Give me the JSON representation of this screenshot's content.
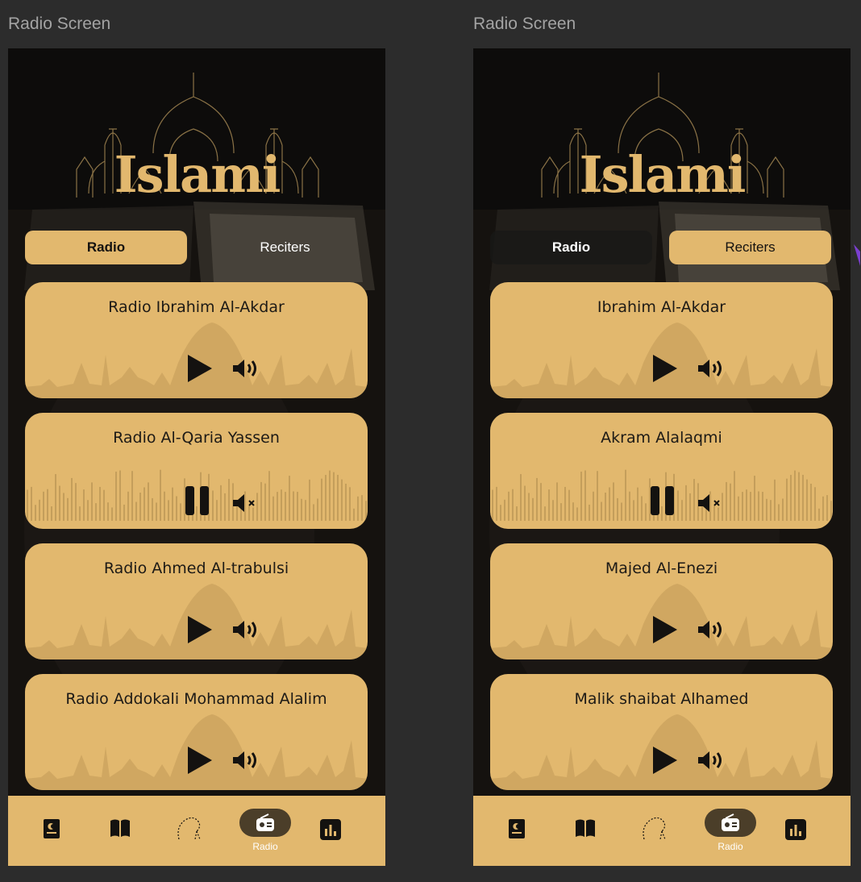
{
  "frames": [
    {
      "title": "Radio Screen",
      "logo": "Islami",
      "tabs": [
        {
          "label": "Radio",
          "active": true
        },
        {
          "label": "Reciters",
          "active": false
        }
      ],
      "cards": [
        {
          "title": "Radio Ibrahim Al-Akdar",
          "state": "paused",
          "muted": false
        },
        {
          "title": "Radio Al-Qaria Yassen",
          "state": "playing",
          "muted": true
        },
        {
          "title": "Radio Ahmed Al-trabulsi",
          "state": "paused",
          "muted": false
        },
        {
          "title": "Radio Addokali Mohammad Alalim",
          "state": "paused",
          "muted": false
        }
      ],
      "nav": {
        "items": [
          "quran-icon",
          "hadith-book-icon",
          "tasbeeh-icon",
          "radio-icon",
          "time-icon"
        ],
        "active_label": "Radio"
      }
    },
    {
      "title": "Radio Screen",
      "logo": "Islami",
      "tabs": [
        {
          "label": "Radio",
          "active": false
        },
        {
          "label": "Reciters",
          "active": true
        }
      ],
      "cards": [
        {
          "title": "Ibrahim Al-Akdar",
          "state": "paused",
          "muted": false
        },
        {
          "title": "Akram Alalaqmi",
          "state": "playing",
          "muted": true
        },
        {
          "title": "Majed Al-Enezi",
          "state": "paused",
          "muted": false
        },
        {
          "title": "Malik shaibat Alhamed",
          "state": "paused",
          "muted": false
        }
      ],
      "nav": {
        "items": [
          "quran-icon",
          "hadith-book-icon",
          "tasbeeh-icon",
          "radio-icon",
          "time-icon"
        ],
        "active_label": "Radio"
      }
    }
  ],
  "colors": {
    "accent": "#E2B86E",
    "dark": "#141210",
    "page_bg": "#2C2C2C"
  }
}
